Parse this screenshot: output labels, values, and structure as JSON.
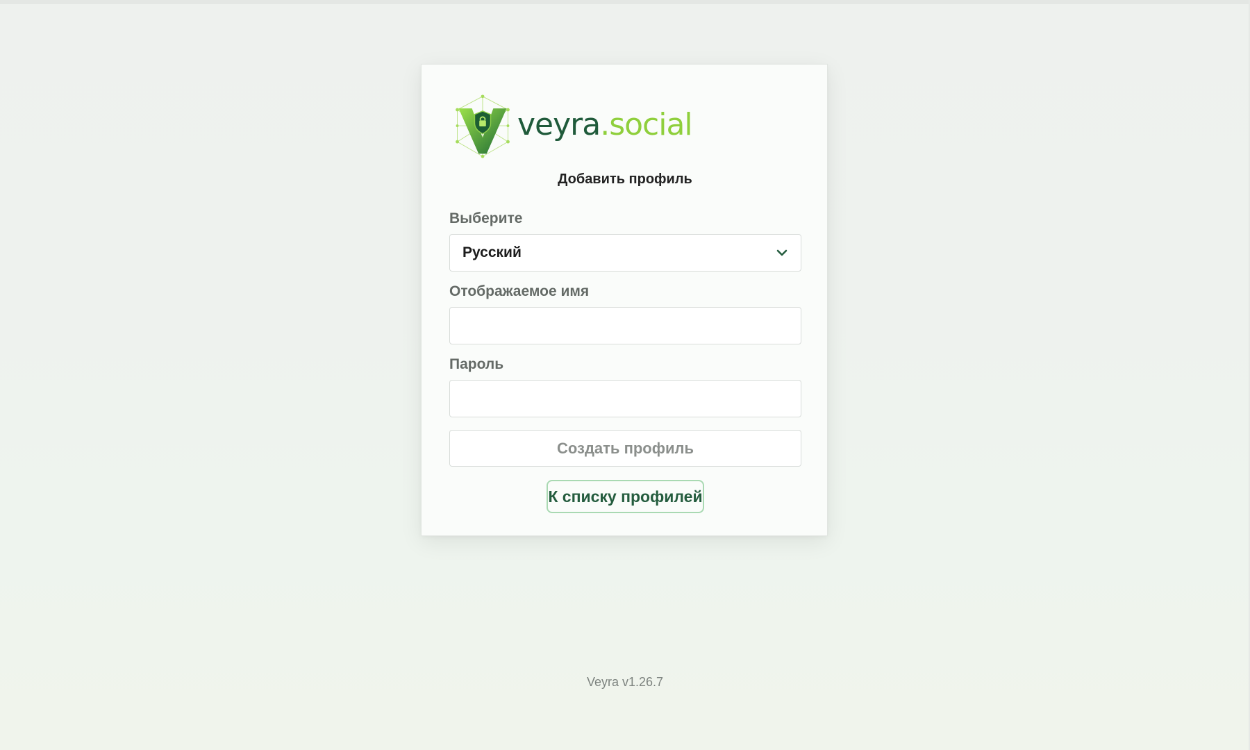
{
  "brand": {
    "name_part1": "veyra",
    "name_part2": ".social",
    "colors": {
      "dark_green": "#1f5a3a",
      "light_green": "#8fcf3c"
    }
  },
  "form": {
    "title": "Добавить профиль",
    "language": {
      "label": "Выберите",
      "selected": "Русский",
      "icon": "chevron-down-icon"
    },
    "display_name": {
      "label": "Отображаемое имя",
      "value": "",
      "placeholder": ""
    },
    "password": {
      "label": "Пароль",
      "value": "",
      "placeholder": ""
    },
    "create_button": "Создать профиль",
    "back_button": "К списку профилей"
  },
  "footer": {
    "version": "Veyra v1.26.7"
  }
}
